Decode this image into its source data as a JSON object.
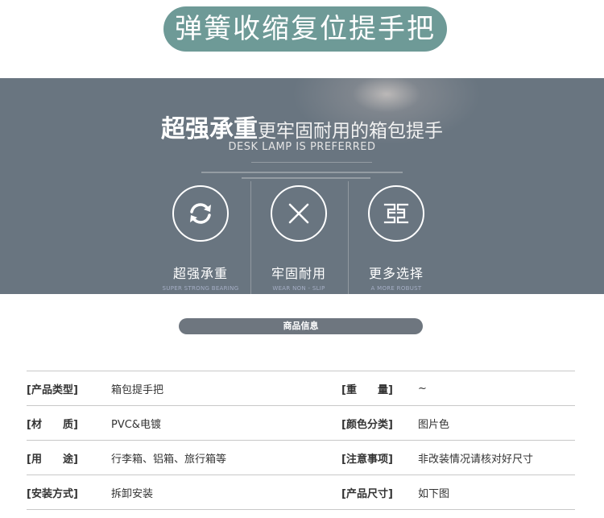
{
  "page_title": "弹簧收缩复位提手把",
  "banner": {
    "headline_strong": "超强承重",
    "headline_light": "更牢固耐用的箱包提手",
    "subtitle_en": "DESK LAMP IS PREFERRED",
    "features": [
      {
        "icon": "refresh-icon",
        "label": "超强承重",
        "sublabel": "SUPER STRONG BEARING"
      },
      {
        "icon": "close-icon",
        "label": "牢固耐用",
        "sublabel": "WEAR NON - SLIP"
      },
      {
        "icon": "pattern-icon",
        "label": "更多选择",
        "sublabel": "A MORE ROBUST"
      }
    ]
  },
  "section_title": "商品信息",
  "specs": [
    {
      "label_left": "[产品类型]",
      "value_left": "箱包提手把",
      "label_right": "[重　　量]",
      "value_right": "~"
    },
    {
      "label_left": "[材　　质]",
      "value_left": "PVC&电镀",
      "label_right": "[颜色分类]",
      "value_right": "图片色"
    },
    {
      "label_left": "[用　　途]",
      "value_left": "行李箱、铝箱、旅行箱等",
      "label_right": "[注意事项]",
      "value_right": "非改装情况请核对好尺寸"
    },
    {
      "label_left": "[安装方式]",
      "value_left": "拆卸安装",
      "label_right": "[产品尺寸]",
      "value_right": "如下图"
    }
  ],
  "colors": {
    "title_pill": "#6e9a97",
    "banner_bg": "#697580",
    "info_pill": "#6e767f"
  }
}
